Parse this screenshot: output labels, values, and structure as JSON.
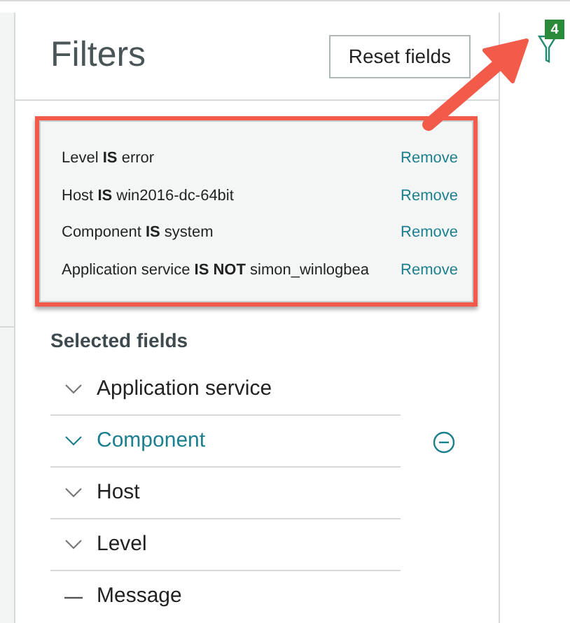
{
  "panel": {
    "title": "Filters",
    "reset_button": "Reset fields"
  },
  "filter_badge": {
    "count": "4"
  },
  "active_filters": [
    {
      "text": "Level **IS** error",
      "action": "Remove"
    },
    {
      "text": "Host **IS** win2016-dc-64bit",
      "action": "Remove"
    },
    {
      "text": "Component **IS** system",
      "action": "Remove"
    },
    {
      "text": "Application service **IS NOT** simon_winlogbea",
      "action": "Remove"
    }
  ],
  "selected_fields": {
    "heading": "Selected fields",
    "items": [
      {
        "label": "Application service",
        "kind": "chevron",
        "selected": false
      },
      {
        "label": "Component",
        "kind": "chevron",
        "selected": true
      },
      {
        "label": "Host",
        "kind": "chevron",
        "selected": false
      },
      {
        "label": "Level",
        "kind": "chevron",
        "selected": false
      },
      {
        "label": "Message",
        "kind": "dash",
        "selected": false
      }
    ]
  }
}
